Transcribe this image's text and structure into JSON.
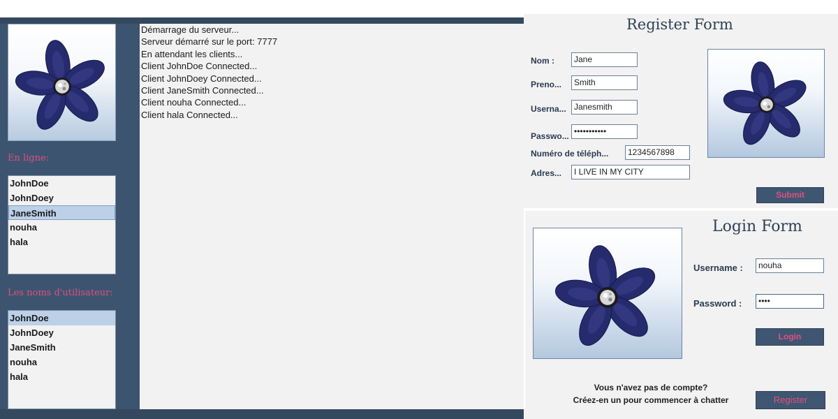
{
  "server": {
    "online_heading": "En ligne:",
    "online_users": [
      "JohnDoe",
      "JohnDoey",
      "JaneSmith",
      "nouha",
      "hala"
    ],
    "usernames_heading": "Les noms d'utilisateur:",
    "usernames": [
      "JohnDoe",
      "JohnDoey",
      "JaneSmith",
      "nouha",
      "hala"
    ],
    "log": [
      "Démarrage du serveur...",
      "Serveur démarré sur le port: 7777",
      "En attendant les clients...",
      "Client JohnDoe Connected...",
      "Client JohnDoey Connected...",
      "Client JaneSmith Connected...",
      "Client nouha Connected...",
      "Client hala Connected..."
    ]
  },
  "register": {
    "title": "Register Form",
    "nom_label": "Nom :",
    "nom_value": "Jane",
    "prenom_label": "Preno...",
    "prenom_value": "Smith",
    "username_label": "Userna...",
    "username_value": "Janesmith",
    "password_label": "Passwo...",
    "password_value": "•••••••••••",
    "phone_label": "Numéro de téléph...",
    "phone_value": "1234567898",
    "address_label": "Adres...",
    "address_value": "I LIVE IN MY CITY",
    "submit_label": "Submit"
  },
  "login": {
    "title": "Login Form",
    "username_label": "Username :",
    "username_value": "nouha",
    "password_label": "Password :",
    "password_value": "••••",
    "login_label": "Login",
    "note_line1": "Vous n'avez pas de compte?",
    "note_line2": "Créez-en un pour commencer à chatter",
    "register_label": "Register"
  },
  "colors": {
    "panel_dark": "#3c5470",
    "accent_pink": "#e0507d",
    "background": "#f2f2f2",
    "selection": "#bcd1e8"
  },
  "icons": [
    "flower-logo-icon"
  ]
}
